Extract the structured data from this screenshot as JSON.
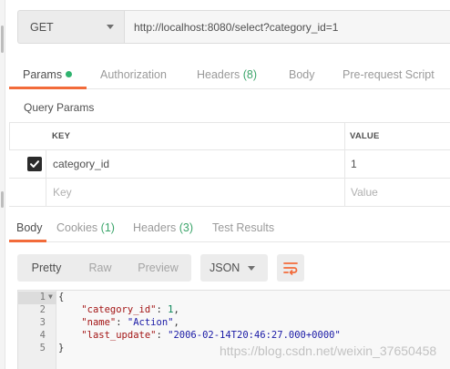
{
  "request": {
    "method": "GET",
    "url": "http://localhost:8080/select?category_id=1"
  },
  "request_tabs": {
    "params": "Params",
    "authorization": "Authorization",
    "headers": "Headers",
    "headers_count": "(8)",
    "body": "Body",
    "prerequest": "Pre-request Script"
  },
  "query_params": {
    "title": "Query Params",
    "columns": {
      "key": "KEY",
      "value": "VALUE"
    },
    "rows": [
      {
        "checked": true,
        "key": "category_id",
        "value": "1"
      }
    ],
    "placeholder": {
      "key": "Key",
      "value": "Value"
    }
  },
  "response_tabs": {
    "body": "Body",
    "cookies": "Cookies",
    "cookies_count": "(1)",
    "headers": "Headers",
    "headers_count": "(3)",
    "tests": "Test Results"
  },
  "view_modes": [
    "Pretty",
    "Raw",
    "Preview"
  ],
  "active_view": "Pretty",
  "format": "JSON",
  "code": {
    "line_numbers": [
      "1",
      "2",
      "3",
      "4",
      "5"
    ],
    "open_brace": "{",
    "close_brace": "}",
    "fields": [
      {
        "key": "\"category_id\"",
        "value": "1",
        "type": "number"
      },
      {
        "key": "\"name\"",
        "value": "\"Action\"",
        "type": "string"
      },
      {
        "key": "\"last_update\"",
        "value": "\"2006-02-14T20:46:27.000+0000\"",
        "type": "string"
      }
    ]
  },
  "watermark": "https://blog.csdn.net/weixin_37650458",
  "colors": {
    "accent": "#f26b3a",
    "success": "#3ca56b",
    "checkbox": "#2b2b2b"
  }
}
